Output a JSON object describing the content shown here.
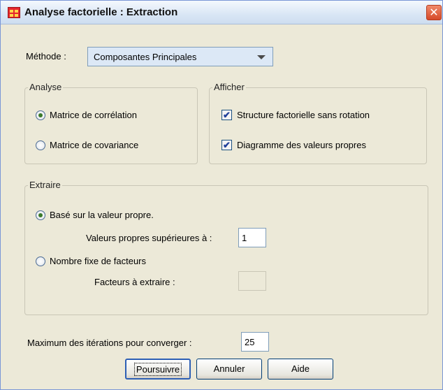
{
  "window": {
    "title": "Analyse factorielle : Extraction",
    "close_glyph": "✕"
  },
  "method": {
    "label": "Méthode :",
    "selected": "Composantes Principales"
  },
  "analyse": {
    "legend": "Analyse",
    "options": [
      {
        "label": "Matrice de corrélation",
        "checked": true
      },
      {
        "label": "Matrice de covariance",
        "checked": false
      }
    ]
  },
  "afficher": {
    "legend": "Afficher",
    "options": [
      {
        "label": "Structure factorielle sans rotation",
        "checked": true
      },
      {
        "label": "Diagramme des valeurs propres",
        "checked": true
      }
    ]
  },
  "extraire": {
    "legend": "Extraire",
    "eigen_option": "Basé sur la valeur propre.",
    "eigen_threshold_label": "Valeurs propres supérieures à :",
    "eigen_threshold_value": "1",
    "fixed_option": "Nombre fixe de facteurs",
    "factors_label": "Facteurs à extraire :",
    "factors_value": ""
  },
  "iterations": {
    "label": "Maximum des itérations pour converger :",
    "value": "25"
  },
  "buttons": {
    "continue": "Poursuivre",
    "cancel": "Annuler",
    "help": "Aide"
  },
  "colors": {
    "dialog_bg": "#ece9d8",
    "title_bg": "#d9e6f5",
    "close_red": "#d64a2a",
    "check_blue": "#1f3f9a"
  },
  "icons": [
    "table-app-icon",
    "close-icon",
    "dropdown-arrow-icon",
    "checkmark-icon"
  ]
}
